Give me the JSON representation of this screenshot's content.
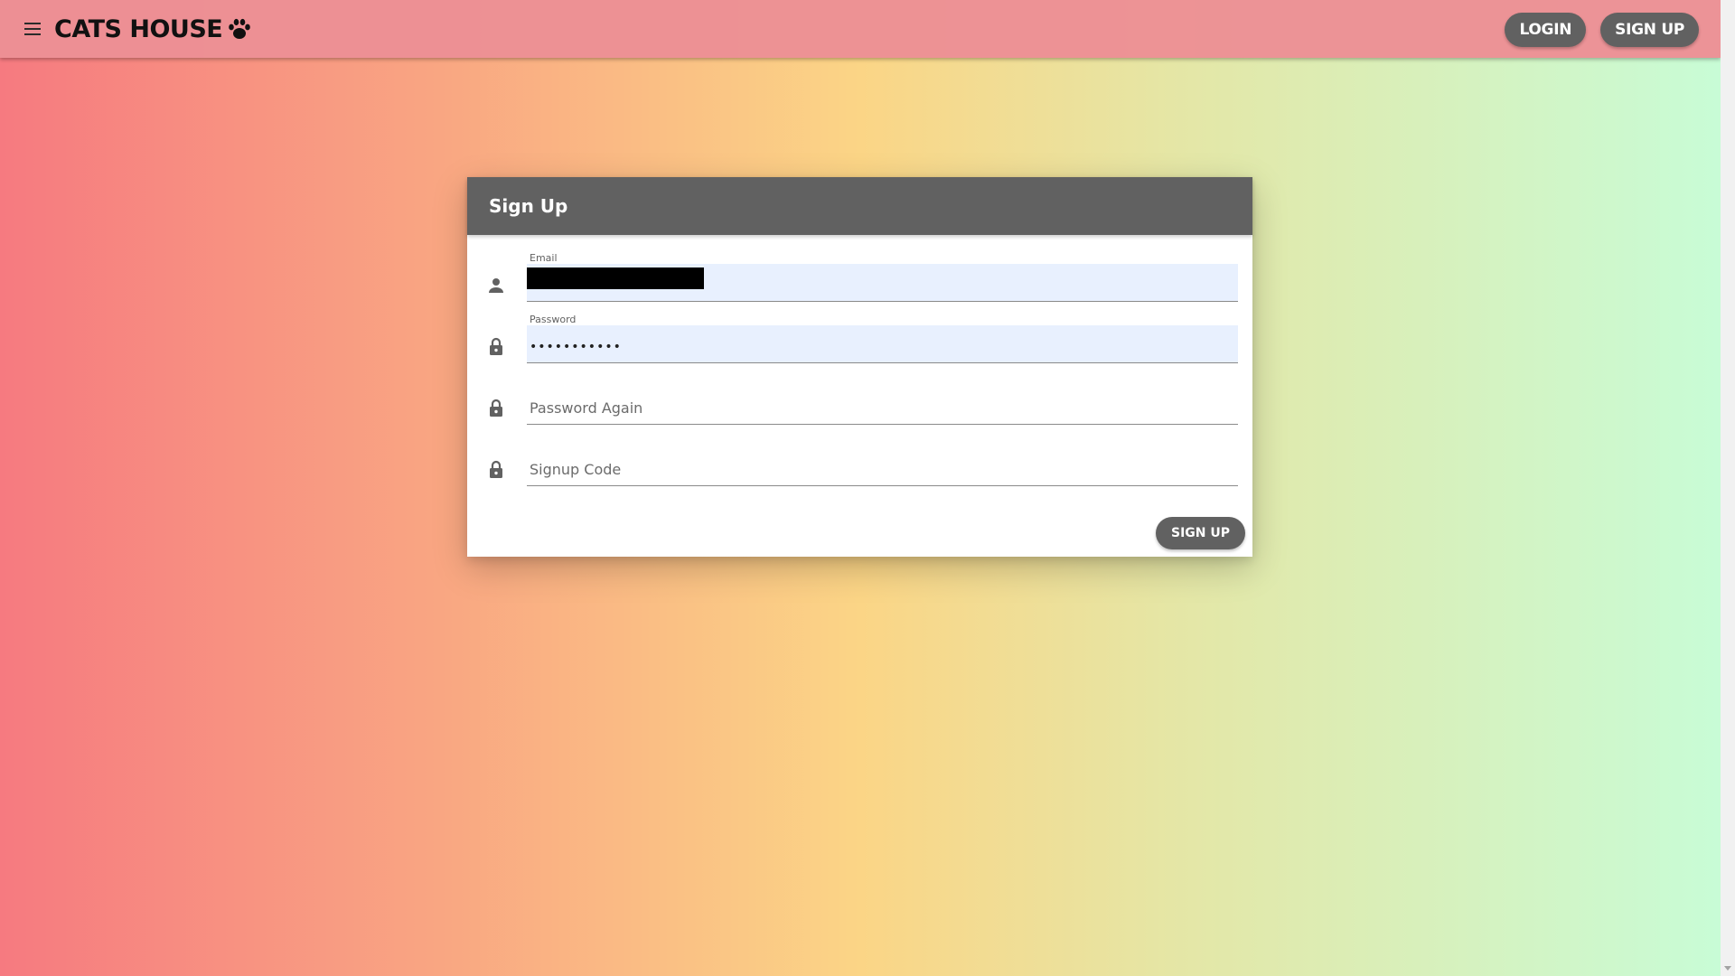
{
  "appbar": {
    "brand": "CATS HOUSE",
    "login_label": "LOGIN",
    "signup_label": "SIGN UP"
  },
  "card": {
    "title": "Sign Up",
    "email": {
      "label": "Email",
      "value_redacted": true
    },
    "password": {
      "label": "Password",
      "value": "•••••••••••"
    },
    "password_again": {
      "placeholder": "Password Again"
    },
    "signup_code": {
      "placeholder": "Signup Code"
    },
    "submit_label": "SIGN UP"
  },
  "icons": {
    "menu": "menu-icon",
    "paw": "paw-icon",
    "email": "person-icon",
    "password": "lock-icon"
  },
  "colors": {
    "gradient": [
      "#f67a80",
      "#f9a582",
      "#fbd586",
      "#e5e6a5",
      "#c8fcd6"
    ],
    "appbar": "#ec9095",
    "button": "#616161",
    "autofill": "#e8f0fe"
  }
}
